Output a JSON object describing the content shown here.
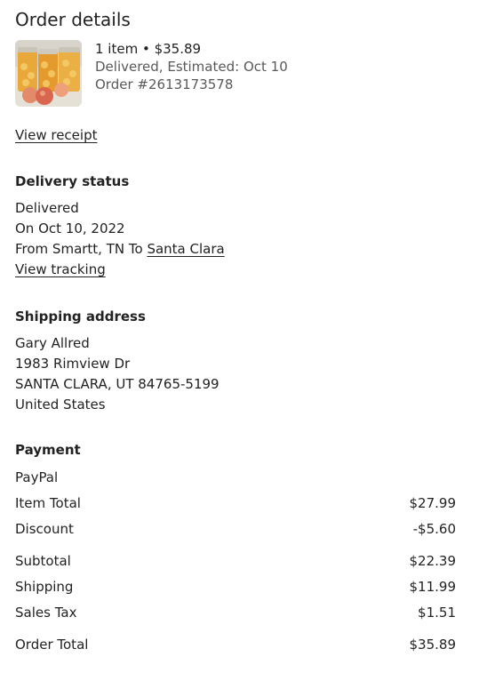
{
  "page": {
    "title": "Order details"
  },
  "order": {
    "summary": "1 item • $35.89",
    "status_line": "Delivered, Estimated: Oct 10",
    "order_number": "Order #2613173578",
    "view_receipt": "View receipt"
  },
  "delivery": {
    "heading": "Delivery status",
    "status": "Delivered",
    "date": "On Oct 10, 2022",
    "route_prefix": "From Smartt, TN To ",
    "destination_link": "Santa Clara",
    "view_tracking": "View tracking"
  },
  "shipping_address": {
    "heading": "Shipping address",
    "name": "Gary Allred",
    "street": "1983 Rimview Dr",
    "city": "SANTA CLARA, UT 84765-5199",
    "country": "United States"
  },
  "payment": {
    "heading": "Payment",
    "method": "PayPal",
    "rows": [
      {
        "label": "Item Total",
        "value": "$27.99"
      },
      {
        "label": "Discount",
        "value": "-$5.60"
      },
      {
        "label": "Subtotal",
        "value": "$22.39"
      },
      {
        "label": "Shipping",
        "value": "$11.99"
      },
      {
        "label": "Sales Tax",
        "value": "$1.51"
      },
      {
        "label": "Order Total",
        "value": "$35.89"
      }
    ]
  },
  "colors": {
    "text": "#222222",
    "muted": "#595959",
    "background": "#ffffff"
  },
  "icons": {
    "thumbnail": "peach-jars-product-image"
  }
}
